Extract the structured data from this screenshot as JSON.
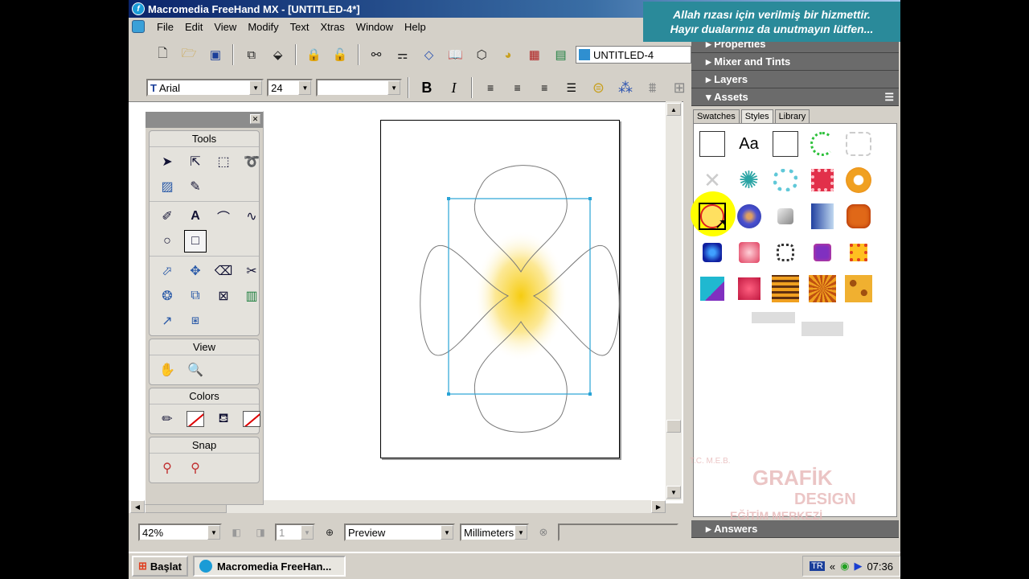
{
  "window": {
    "title": "Macromedia FreeHand MX - [UNTITLED-4*]"
  },
  "caption": {
    "line1": "Allah rızası için verilmiş bir hizmettir.",
    "line2": "Hayır dualarınız da unutmayın lütfen..."
  },
  "menu": [
    "File",
    "Edit",
    "View",
    "Modify",
    "Text",
    "Xtras",
    "Window",
    "Help"
  ],
  "main_toolbar": {
    "document_name": "UNTITLED-4"
  },
  "text_toolbar": {
    "font": "Arial",
    "size": "24",
    "bold": "B",
    "italic": "I"
  },
  "tools_panel": {
    "sections": {
      "tools": "Tools",
      "view": "View",
      "colors": "Colors",
      "snap": "Snap"
    }
  },
  "panels": {
    "properties": "Properties",
    "mixer": "Mixer and Tints",
    "layers": "Layers",
    "assets": "Assets",
    "answers": "Answers"
  },
  "assets_tabs": [
    "Swatches",
    "Styles",
    "Library"
  ],
  "styles_first_label": "Aa",
  "statusbar": {
    "zoom": "42%",
    "page": "1",
    "view_mode": "Preview",
    "units": "Millimeters"
  },
  "watermark": {
    "org": "T.C. M.E.B.",
    "brand": "GRAFİK",
    "sub": "DESIGN",
    "sub2": "EĞİTİM MERKEZİ"
  },
  "taskbar": {
    "start": "Başlat",
    "task": "Macromedia FreeHan...",
    "lang": "TR",
    "time": "07:36"
  },
  "colors": {
    "title_bar": "#0a246a",
    "selection": "#29a3d6",
    "highlight": "#ffff00",
    "caption_bg": "#2a8a9a"
  }
}
